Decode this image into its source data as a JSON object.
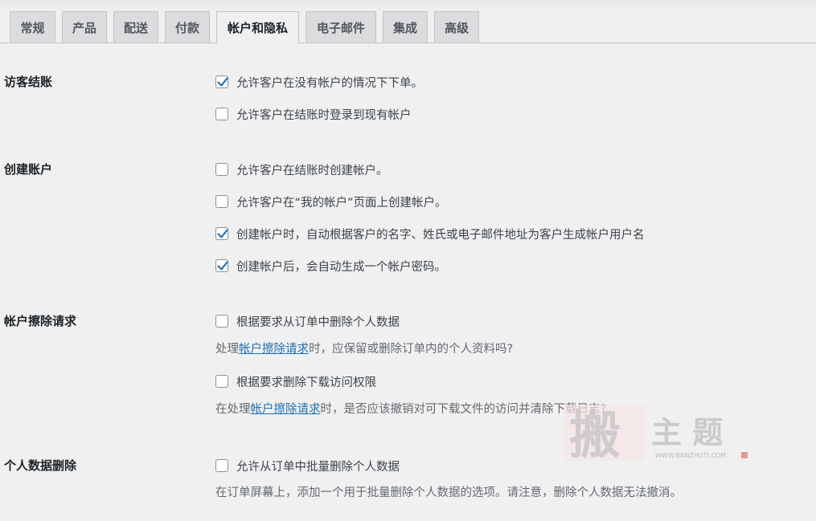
{
  "tabs": [
    {
      "label": "常规",
      "active": false
    },
    {
      "label": "产品",
      "active": false
    },
    {
      "label": "配送",
      "active": false
    },
    {
      "label": "付款",
      "active": false
    },
    {
      "label": "帐户和隐私",
      "active": true
    },
    {
      "label": "电子邮件",
      "active": false
    },
    {
      "label": "集成",
      "active": false
    },
    {
      "label": "高级",
      "active": false
    }
  ],
  "guest_checkout": {
    "title": "访客结账",
    "options": [
      {
        "label": "允许客户在没有帐户的情况下下单。",
        "checked": true
      },
      {
        "label": "允许客户在结账时登录到现有帐户",
        "checked": false
      }
    ]
  },
  "account_creation": {
    "title": "创建账户",
    "options": [
      {
        "label": "允许客户在结账时创建帐户。",
        "checked": false
      },
      {
        "label": "允许客户在“我的帐户”页面上创建帐户。",
        "checked": false
      },
      {
        "label": "创建帐户时，自动根据客户的名字、姓氏或电子邮件地址为客户生成帐户用户名",
        "checked": true
      },
      {
        "label": "创建帐户后，会自动生成一个帐户密码。",
        "checked": true
      }
    ]
  },
  "erasure_requests": {
    "title": "帐户擦除请求",
    "options": [
      {
        "label": "根据要求从订单中删除个人数据",
        "checked": false
      },
      {
        "label": "根据要求删除下载访问权限",
        "checked": false
      }
    ],
    "desc1": {
      "prefix": "处理",
      "link": "帐户擦除请求",
      "suffix": "时，应保留或删除订单内的个人资料吗?"
    },
    "desc2": {
      "prefix": "在处理",
      "link": "帐户擦除请求",
      "suffix": "时，是否应该撤销对可下载文件的访问并清除下载日志?"
    }
  },
  "personal_data_removal": {
    "title": "个人数据删除",
    "options": [
      {
        "label": "允许从订单中批量删除个人数据",
        "checked": false
      }
    ],
    "desc": "在订单屏幕上，添加一个用于批量删除个人数据的选项。请注意，删除个人数据无法撤消。"
  },
  "watermark": {
    "glyph": "搬",
    "text": "主 题",
    "url": "WWW.BANZHUTI.COM"
  },
  "colors": {
    "checkmark": "#2271b1",
    "link": "#2271b1",
    "watermark_red": "#d9a3a3"
  }
}
